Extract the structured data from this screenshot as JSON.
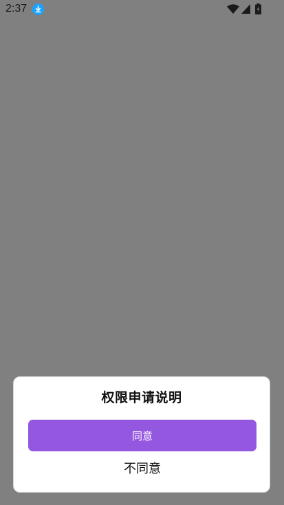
{
  "status_bar": {
    "time": "2:37",
    "icons": [
      "download-icon",
      "wifi-icon",
      "signal-icon",
      "battery-icon"
    ],
    "download_icon_color": "#1aa3ff"
  },
  "dialog": {
    "title": "权限申请说明",
    "agree_label": "同意",
    "disagree_label": "不同意",
    "agree_button_color": "#9457e0"
  },
  "colors": {
    "backdrop": "#808080",
    "dialog_background": "#ffffff"
  }
}
